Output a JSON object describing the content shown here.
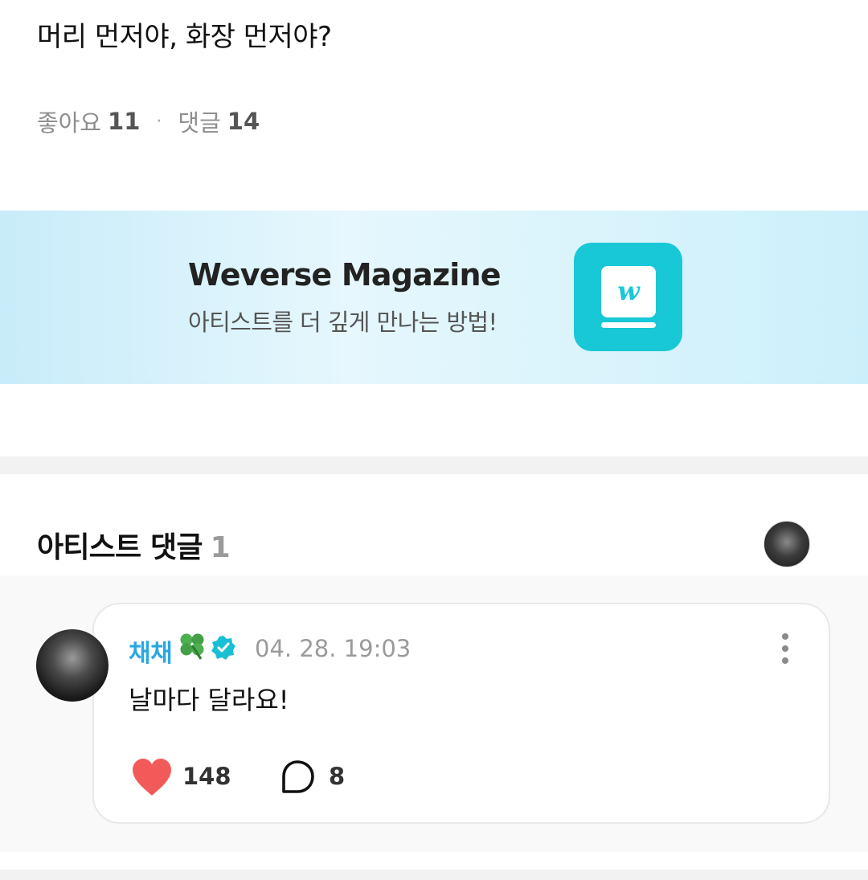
{
  "post": {
    "title": "머리 먼저야, 화장 먼저야?",
    "likes_label": "좋아요",
    "likes_count": "11",
    "separator": "·",
    "comments_label": "댓글",
    "comments_count": "14"
  },
  "banner": {
    "title": "Weverse Magazine",
    "subtitle": "아티스트를 더 깊게 만나는 방법!",
    "logo_icon": "weverse-book-icon",
    "accent_color": "#18c8d6"
  },
  "artist_comments": {
    "heading": "아티스트 댓글",
    "count": "1",
    "comment": {
      "author": "채채",
      "author_emoji_icon": "four-leaf-clover-icon",
      "verified_icon": "verified-badge-icon",
      "date": "04. 28. 19:03",
      "text": "날마다 달라요!",
      "like_count": "148",
      "reply_count": "8",
      "name_color": "#2aa8e0",
      "heart_color": "#f25a5a"
    }
  }
}
